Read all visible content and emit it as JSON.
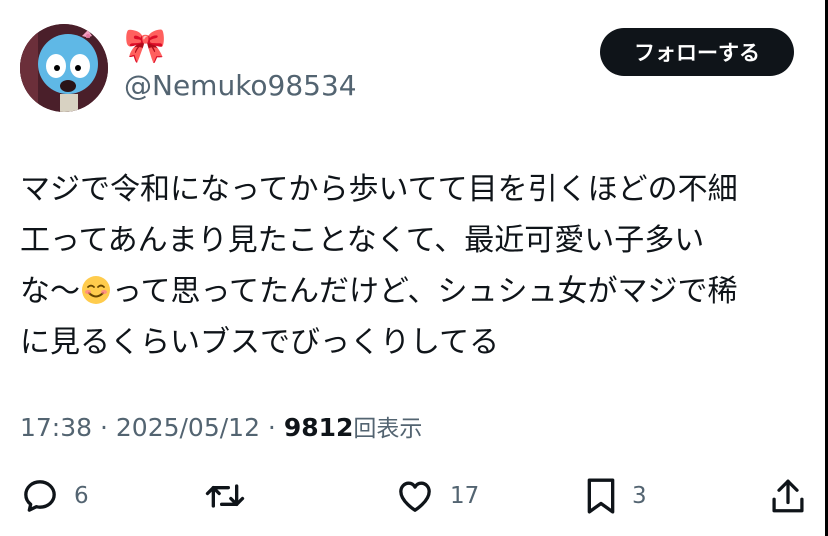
{
  "header": {
    "display_name": "🎀",
    "handle": "@Nemuko98534",
    "follow_label": "フォローする"
  },
  "tweet": {
    "line1": "マジで令和になってから歩いてて目を引くほどの不細",
    "line2": "工ってあんまり見たことなくて、最近可愛い子多い",
    "line3_before": "な〜",
    "line3_emoji": "☺️",
    "line3_after": "って思ってたんだけど、シュシュ女がマジで稀",
    "line4": "に見るくらいブスでびっくりしてる"
  },
  "meta": {
    "time": "17:38",
    "sep1": " · ",
    "date": "2025/05/12",
    "sep2": " · ",
    "views_count": "9812",
    "views_label": "回表示"
  },
  "actions": {
    "reply_count": "6",
    "repost_count": "",
    "like_count": "17",
    "bookmark_count": "3"
  },
  "icons": {
    "reply": "reply-icon",
    "repost": "repost-icon",
    "like": "heart-icon",
    "bookmark": "bookmark-icon",
    "share": "share-icon"
  },
  "colors": {
    "text": "#0f1419",
    "secondary": "#536471",
    "button_bg": "#0f1419"
  }
}
